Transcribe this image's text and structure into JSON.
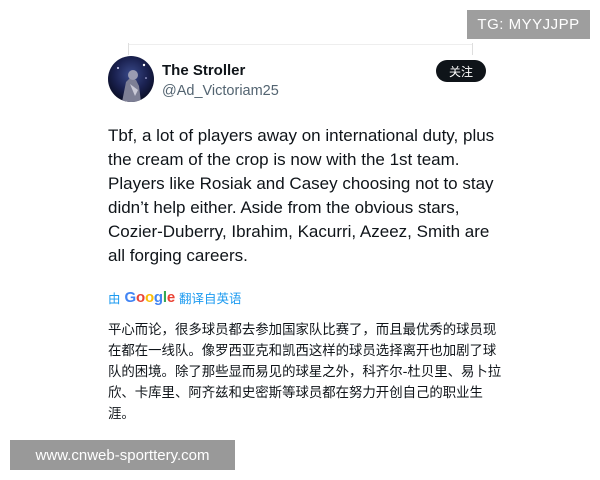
{
  "overlay": {
    "tg_badge": "TG: MYYJJPP",
    "watermark": "www.cnweb-sporttery.com"
  },
  "tweet": {
    "display_name": "The Stroller",
    "handle": "@Ad_Victoriam25",
    "follow_label": "关注",
    "body": "Tbf, a lot of players away on international duty, plus the cream of the crop is now with the 1st team. Players like Rosiak and Casey choosing not to stay didn’t help either. Aside from the obvious stars, Cozier-Duberry, Ibrahim, Kacurri, Azeez, Smith are all forging careers.",
    "translate": {
      "prefix": "由",
      "brand": "Google",
      "suffix": "翻译自英语"
    },
    "translated_body": "平心而论，很多球员都去参加国家队比赛了，而且最优秀的球员现在都在一线队。像罗西亚克和凯西这样的球员选择离开也加剧了球队的困境。除了那些显而易见的球星之外，科齐尔-杜贝里、易卜拉欣、卡库里、阿齐兹和史密斯等球员都在努力开创自己的职业生涯。"
  },
  "colors": {
    "accent_link": "#1d9bf0",
    "follow_bg": "#0f1419",
    "secondary_text": "#536471"
  }
}
